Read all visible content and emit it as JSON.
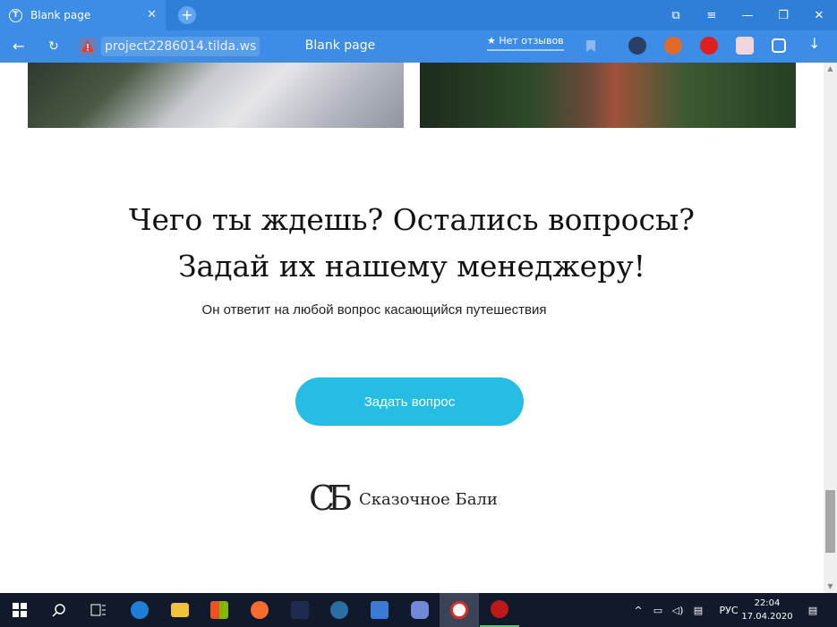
{
  "browser": {
    "tab_title": "Blank page",
    "tab_close": "✕",
    "new_tab": "+",
    "url": "project2286014.tilda.ws",
    "page_title": "Blank page",
    "reviews_label": "★ Нет отзывов",
    "window_controls": [
      "⧉",
      "≡",
      "—",
      "❐",
      "✕"
    ],
    "accent_color": "#2f7fd8"
  },
  "content": {
    "headline_line1": "Чего ты ждешь? Остались вопросы?",
    "headline_line2": "Задай их нашему менеджеру!",
    "subtitle": "Он ответит на любой вопрос касающийся путешествия",
    "cta_label": "Задать вопрос",
    "cta_color": "#25bde3",
    "logo_mark": "СБ",
    "logo_text": "Сказочное Бали"
  },
  "taskbar": {
    "apps": [
      "start-icon",
      "search-icon",
      "task-view-icon",
      "edge-icon",
      "explorer-icon",
      "store-icon",
      "origin-icon",
      "game-icon",
      "steam-icon",
      "toolbox-icon",
      "discord-icon",
      "yandex-browser-icon",
      "app-icon"
    ],
    "language": "РУС",
    "time": "22:04",
    "date": "17.04.2020"
  }
}
